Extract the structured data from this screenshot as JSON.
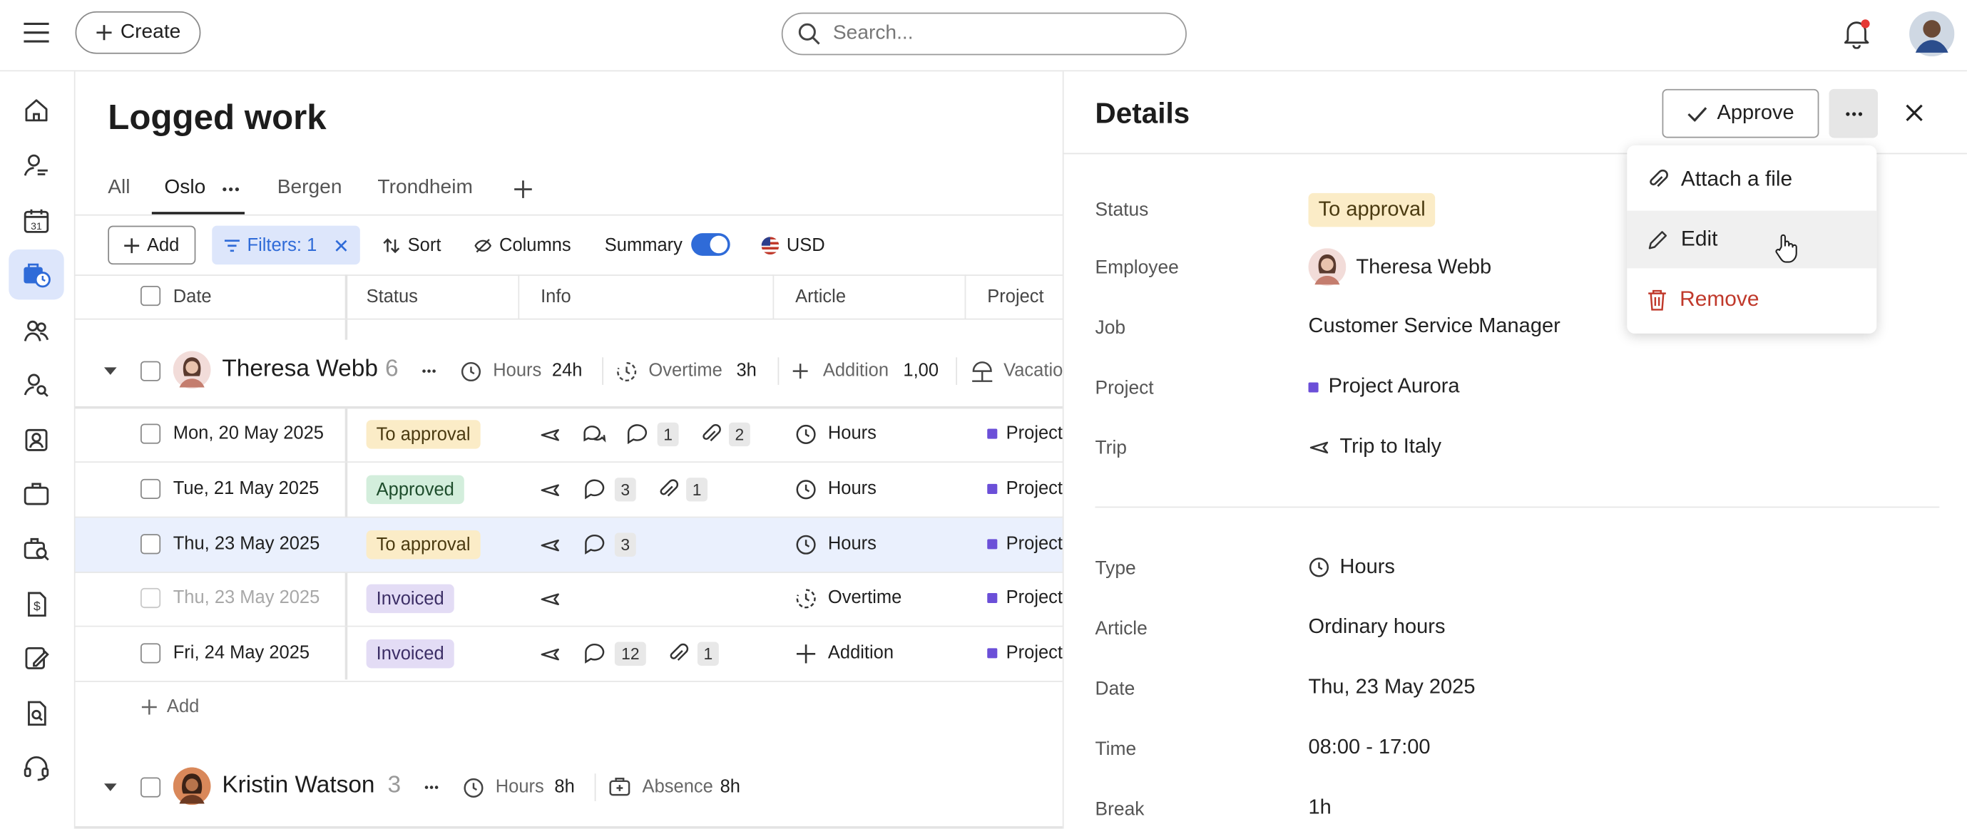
{
  "topbar": {
    "create_label": "Create",
    "search_placeholder": "Search..."
  },
  "sidebar": {
    "icons": [
      "home-icon",
      "payroll-user-icon",
      "calendar-icon",
      "logged-work-icon",
      "people-icon",
      "user-search-icon",
      "contact-card-icon",
      "briefcase-icon",
      "job-search-icon",
      "invoice-icon",
      "edit-document-icon",
      "document-search-icon",
      "support-icon"
    ],
    "calendar_day": "31"
  },
  "page": {
    "title": "Logged work"
  },
  "tabs": [
    {
      "label": "All"
    },
    {
      "label": "Oslo",
      "active": true
    },
    {
      "label": "Bergen"
    },
    {
      "label": "Trondheim"
    }
  ],
  "toolbar": {
    "add_label": "Add",
    "filters_label": "Filters: 1",
    "sort_label": "Sort",
    "columns_label": "Columns",
    "summary_label": "Summary",
    "summary_on": true,
    "currency_label": "USD"
  },
  "columns": [
    "Date",
    "Status",
    "Info",
    "Article",
    "Project"
  ],
  "groups": [
    {
      "name": "Theresa Webb",
      "count": "6",
      "hours_label": "Hours",
      "hours_value": "24h",
      "overtime_label": "Overtime",
      "overtime_value": "3h",
      "addition_label": "Addition",
      "addition_value": "1,00",
      "vacation_label": "Vacatio"
    },
    {
      "name": "Kristin Watson",
      "count": "3",
      "hours_label": "Hours",
      "hours_value": "8h",
      "absence_label": "Absence",
      "absence_value": "8h"
    }
  ],
  "rows": [
    {
      "date": "Mon, 20 May 2025",
      "status": "To approval",
      "comments": "1",
      "attachments": "2",
      "article": "Hours",
      "project": "Project"
    },
    {
      "date": "Tue, 21 May 2025",
      "status": "Approved",
      "comments": "3",
      "attachments": "1",
      "article": "Hours",
      "project": "Project"
    },
    {
      "date": "Thu, 23 May 2025",
      "status": "To approval",
      "comments": "3",
      "article": "Hours",
      "project": "Project"
    },
    {
      "date": "Thu, 23 May 2025",
      "status": "Invoiced",
      "article": "Overtime",
      "project": "Project"
    },
    {
      "date": "Fri, 24 May 2025",
      "status": "Invoiced",
      "comments": "12",
      "attachments": "1",
      "article": "Addition",
      "project": "Project"
    }
  ],
  "add_row_label": "Add",
  "details": {
    "title": "Details",
    "approve_label": "Approve",
    "fields": {
      "status_label": "Status",
      "status_value": "To approval",
      "employee_label": "Employee",
      "employee_value": "Theresa Webb",
      "job_label": "Job",
      "job_value": "Customer Service Manager",
      "project_label": "Project",
      "project_value": "Project Aurora",
      "trip_label": "Trip",
      "trip_value": "Trip to Italy",
      "type_label": "Type",
      "type_value": "Hours",
      "article_label": "Article",
      "article_value": "Ordinary hours",
      "date_label": "Date",
      "date_value": "Thu, 23 May 2025",
      "time_label": "Time",
      "time_value": "08:00 - 17:00",
      "break_label": "Break",
      "break_value": "1h"
    }
  },
  "menu": {
    "attach_label": "Attach a file",
    "edit_label": "Edit",
    "remove_label": "Remove"
  },
  "colors": {
    "accent": "#2f6bd8",
    "project_dot": "#6b4fd8",
    "remove_red": "#c0392b",
    "notification_dot": "#e53935"
  }
}
